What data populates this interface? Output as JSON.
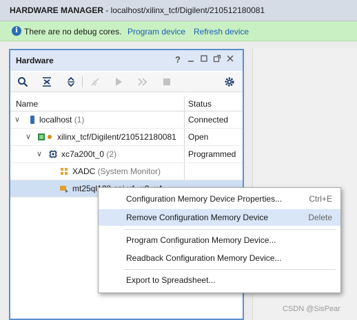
{
  "header": {
    "title_bold": "HARDWARE MANAGER",
    "title_rest": " - localhost/xilinx_tcf/Digilent/210512180081"
  },
  "banner": {
    "info_icon": "i",
    "message": "There are no debug cores.",
    "program_link": "Program device",
    "refresh_link": "Refresh device"
  },
  "panel": {
    "title": "Hardware",
    "help_icon": "?",
    "columns": {
      "name": "Name",
      "status": "Status"
    },
    "rows": [
      {
        "name": "localhost",
        "detail": " (1)",
        "status": "Connected"
      },
      {
        "name": "xilinx_tcf/Digilent/210512180081",
        "detail": "",
        "status": "Open"
      },
      {
        "name": "xc7a200t_0",
        "detail": " (2)",
        "status": "Programmed"
      },
      {
        "name": "XADC",
        "detail": " (System Monitor)",
        "status": ""
      },
      {
        "name": "mt25ql128-spi-x1_x2_x4",
        "detail": "",
        "status": ""
      }
    ]
  },
  "context_menu": {
    "items": [
      {
        "label": "Configuration Memory Device Properties...",
        "shortcut": "Ctrl+E"
      },
      {
        "label": "Remove Configuration Memory Device",
        "shortcut": "Delete"
      },
      {
        "label": "Program Configuration Memory Device...",
        "shortcut": ""
      },
      {
        "label": "Readback Configuration Memory Device...",
        "shortcut": ""
      },
      {
        "label": "Export to Spreadsheet...",
        "shortcut": ""
      }
    ]
  },
  "watermark": "CSDN @SisPear",
  "colors": {
    "accent": "#5b8fd0",
    "banner_bg": "#c9f0c2",
    "link": "#1a5fb4",
    "selection": "#cfdff3"
  }
}
